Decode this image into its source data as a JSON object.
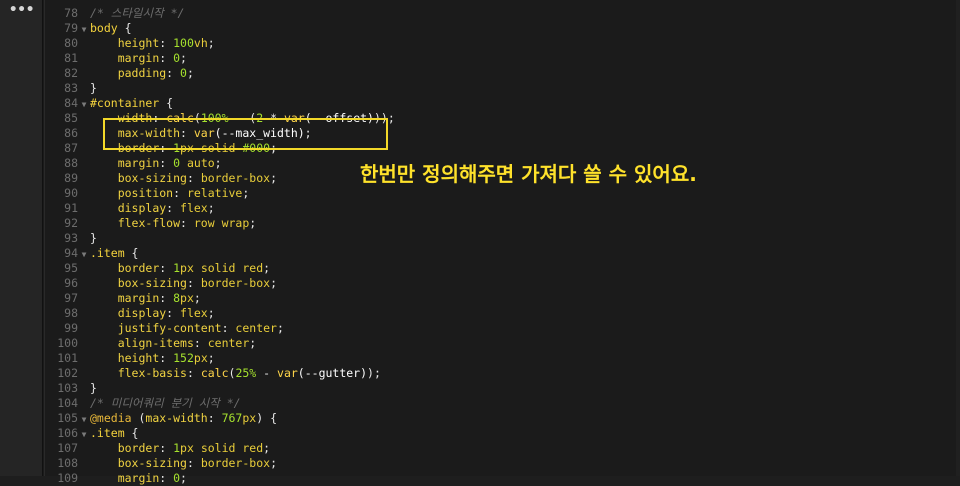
{
  "sidebar": {
    "menu_glyph": "•••"
  },
  "annotation": {
    "text": "한번만 정의해주면 가져다 쓸 수 있어요."
  },
  "lines": [
    {
      "n": "78",
      "fold": "",
      "tokens": [
        [
          "/* 스타일시작 */",
          "com"
        ]
      ]
    },
    {
      "n": "79",
      "fold": "▼",
      "tokens": [
        [
          "body",
          "sel"
        ],
        [
          " {",
          "pun"
        ]
      ]
    },
    {
      "n": "80",
      "fold": "",
      "tokens": [
        [
          "    ",
          ""
        ],
        [
          "height",
          "prop"
        ],
        [
          ": ",
          "pun"
        ],
        [
          "100",
          "num"
        ],
        [
          "vh",
          "val"
        ],
        [
          ";",
          "pun"
        ]
      ]
    },
    {
      "n": "81",
      "fold": "",
      "tokens": [
        [
          "    ",
          ""
        ],
        [
          "margin",
          "prop"
        ],
        [
          ": ",
          "pun"
        ],
        [
          "0",
          "num"
        ],
        [
          ";",
          "pun"
        ]
      ]
    },
    {
      "n": "82",
      "fold": "",
      "tokens": [
        [
          "    ",
          ""
        ],
        [
          "padding",
          "prop"
        ],
        [
          ": ",
          "pun"
        ],
        [
          "0",
          "num"
        ],
        [
          ";",
          "pun"
        ]
      ]
    },
    {
      "n": "83",
      "fold": "",
      "tokens": [
        [
          "}",
          "pun"
        ]
      ]
    },
    {
      "n": "84",
      "fold": "▼",
      "tokens": [
        [
          "#container",
          "sel"
        ],
        [
          " {",
          "pun"
        ]
      ]
    },
    {
      "n": "85",
      "fold": "",
      "tokens": [
        [
          "    ",
          ""
        ],
        [
          "width",
          "prop"
        ],
        [
          ": ",
          "pun"
        ],
        [
          "calc",
          "func"
        ],
        [
          "(",
          "pun"
        ],
        [
          "100%",
          "num"
        ],
        [
          " - (",
          "pun"
        ],
        [
          "2",
          "num"
        ],
        [
          " * ",
          "pun"
        ],
        [
          "var",
          "func"
        ],
        [
          "(--offset)",
          "var"
        ],
        [
          "));",
          "pun"
        ]
      ]
    },
    {
      "n": "86",
      "fold": "",
      "tokens": [
        [
          "    ",
          ""
        ],
        [
          "max-width",
          "prop"
        ],
        [
          ": ",
          "pun"
        ],
        [
          "var",
          "func"
        ],
        [
          "(--max_width)",
          "var"
        ],
        [
          ";",
          "pun"
        ]
      ]
    },
    {
      "n": "87",
      "fold": "",
      "tokens": [
        [
          "    ",
          ""
        ],
        [
          "border",
          "prop"
        ],
        [
          ": ",
          "pun"
        ],
        [
          "1",
          "num"
        ],
        [
          "px",
          "val"
        ],
        [
          " solid ",
          "val"
        ],
        [
          "#000",
          "num"
        ],
        [
          ";",
          "pun"
        ]
      ]
    },
    {
      "n": "88",
      "fold": "",
      "tokens": [
        [
          "    ",
          ""
        ],
        [
          "margin",
          "prop"
        ],
        [
          ": ",
          "pun"
        ],
        [
          "0",
          "num"
        ],
        [
          " auto",
          "val"
        ],
        [
          ";",
          "pun"
        ]
      ]
    },
    {
      "n": "89",
      "fold": "",
      "tokens": [
        [
          "    ",
          ""
        ],
        [
          "box-sizing",
          "prop"
        ],
        [
          ": ",
          "pun"
        ],
        [
          "border-box",
          "val"
        ],
        [
          ";",
          "pun"
        ]
      ]
    },
    {
      "n": "90",
      "fold": "",
      "tokens": [
        [
          "    ",
          ""
        ],
        [
          "position",
          "prop"
        ],
        [
          ": ",
          "pun"
        ],
        [
          "relative",
          "val"
        ],
        [
          ";",
          "pun"
        ]
      ]
    },
    {
      "n": "91",
      "fold": "",
      "tokens": [
        [
          "    ",
          ""
        ],
        [
          "display",
          "prop"
        ],
        [
          ": ",
          "pun"
        ],
        [
          "flex",
          "val"
        ],
        [
          ";",
          "pun"
        ]
      ]
    },
    {
      "n": "92",
      "fold": "",
      "tokens": [
        [
          "    ",
          ""
        ],
        [
          "flex-flow",
          "prop"
        ],
        [
          ": ",
          "pun"
        ],
        [
          "row wrap",
          "val"
        ],
        [
          ";",
          "pun"
        ]
      ]
    },
    {
      "n": "93",
      "fold": "",
      "tokens": [
        [
          "}",
          "pun"
        ]
      ]
    },
    {
      "n": "94",
      "fold": "▼",
      "tokens": [
        [
          ".item",
          "sel"
        ],
        [
          " {",
          "pun"
        ]
      ]
    },
    {
      "n": "95",
      "fold": "",
      "tokens": [
        [
          "    ",
          ""
        ],
        [
          "border",
          "prop"
        ],
        [
          ": ",
          "pun"
        ],
        [
          "1",
          "num"
        ],
        [
          "px",
          "val"
        ],
        [
          " solid red",
          "val"
        ],
        [
          ";",
          "pun"
        ]
      ]
    },
    {
      "n": "96",
      "fold": "",
      "tokens": [
        [
          "    ",
          ""
        ],
        [
          "box-sizing",
          "prop"
        ],
        [
          ": ",
          "pun"
        ],
        [
          "border-box",
          "val"
        ],
        [
          ";",
          "pun"
        ]
      ]
    },
    {
      "n": "97",
      "fold": "",
      "tokens": [
        [
          "    ",
          ""
        ],
        [
          "margin",
          "prop"
        ],
        [
          ": ",
          "pun"
        ],
        [
          "8",
          "num"
        ],
        [
          "px",
          "val"
        ],
        [
          ";",
          "pun"
        ]
      ]
    },
    {
      "n": "98",
      "fold": "",
      "tokens": [
        [
          "    ",
          ""
        ],
        [
          "display",
          "prop"
        ],
        [
          ": ",
          "pun"
        ],
        [
          "flex",
          "val"
        ],
        [
          ";",
          "pun"
        ]
      ]
    },
    {
      "n": "99",
      "fold": "",
      "tokens": [
        [
          "    ",
          ""
        ],
        [
          "justify-content",
          "prop"
        ],
        [
          ": ",
          "pun"
        ],
        [
          "center",
          "val"
        ],
        [
          ";",
          "pun"
        ]
      ]
    },
    {
      "n": "100",
      "fold": "",
      "tokens": [
        [
          "    ",
          ""
        ],
        [
          "align-items",
          "prop"
        ],
        [
          ": ",
          "pun"
        ],
        [
          "center",
          "val"
        ],
        [
          ";",
          "pun"
        ]
      ]
    },
    {
      "n": "101",
      "fold": "",
      "tokens": [
        [
          "    ",
          ""
        ],
        [
          "height",
          "prop"
        ],
        [
          ": ",
          "pun"
        ],
        [
          "152",
          "num"
        ],
        [
          "px",
          "val"
        ],
        [
          ";",
          "pun"
        ]
      ]
    },
    {
      "n": "102",
      "fold": "",
      "tokens": [
        [
          "    ",
          ""
        ],
        [
          "flex-basis",
          "prop"
        ],
        [
          ": ",
          "pun"
        ],
        [
          "calc",
          "func"
        ],
        [
          "(",
          "pun"
        ],
        [
          "25%",
          "num"
        ],
        [
          " - ",
          "pun"
        ],
        [
          "var",
          "func"
        ],
        [
          "(--gutter)",
          "var"
        ],
        [
          ");",
          "pun"
        ]
      ]
    },
    {
      "n": "103",
      "fold": "",
      "tokens": [
        [
          "}",
          "pun"
        ]
      ]
    },
    {
      "n": "104",
      "fold": "",
      "tokens": [
        [
          "/* 미디어쿼리 분기 시작 */",
          "com"
        ]
      ]
    },
    {
      "n": "105",
      "fold": "▼",
      "tokens": [
        [
          "@media",
          "at"
        ],
        [
          " (",
          "pun"
        ],
        [
          "max-width",
          "prop"
        ],
        [
          ": ",
          "pun"
        ],
        [
          "767",
          "num"
        ],
        [
          "px",
          "val"
        ],
        [
          ") {",
          "pun"
        ]
      ]
    },
    {
      "n": "106",
      "fold": "▼",
      "tokens": [
        [
          ".item",
          "sel"
        ],
        [
          " {",
          "pun"
        ]
      ]
    },
    {
      "n": "107",
      "fold": "",
      "tokens": [
        [
          "    ",
          ""
        ],
        [
          "border",
          "prop"
        ],
        [
          ": ",
          "pun"
        ],
        [
          "1",
          "num"
        ],
        [
          "px",
          "val"
        ],
        [
          " solid red",
          "val"
        ],
        [
          ";",
          "pun"
        ]
      ]
    },
    {
      "n": "108",
      "fold": "",
      "tokens": [
        [
          "    ",
          ""
        ],
        [
          "box-sizing",
          "prop"
        ],
        [
          ": ",
          "pun"
        ],
        [
          "border-box",
          "val"
        ],
        [
          ";",
          "pun"
        ]
      ]
    },
    {
      "n": "109",
      "fold": "",
      "tokens": [
        [
          "    ",
          ""
        ],
        [
          "margin",
          "prop"
        ],
        [
          ": ",
          "pun"
        ],
        [
          "0",
          "num"
        ],
        [
          ";",
          "pun"
        ]
      ]
    }
  ]
}
